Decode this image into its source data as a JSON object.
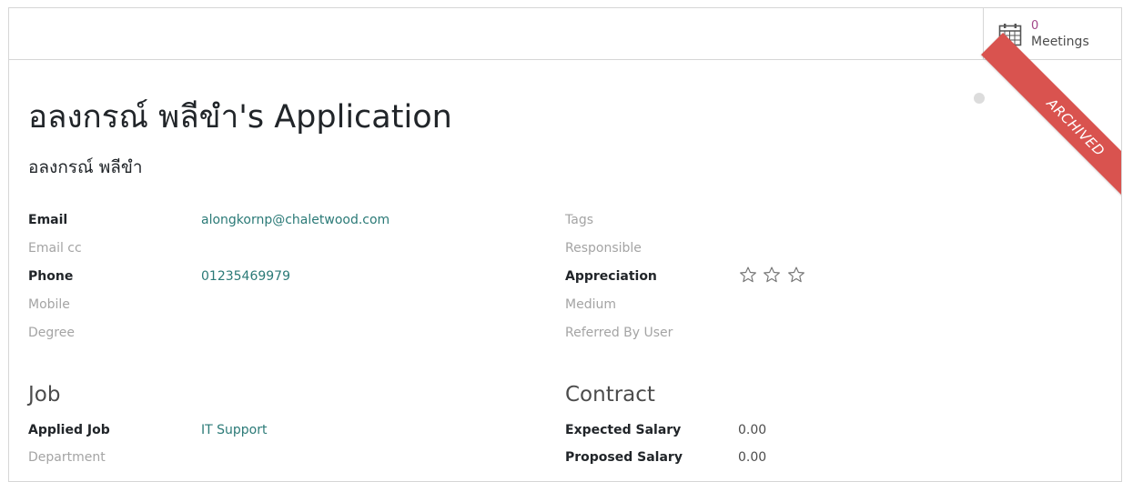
{
  "meetings": {
    "count": "0",
    "label": "Meetings"
  },
  "ribbon": {
    "text": "ARCHIVED"
  },
  "title": "อลงกรณ์ พลีขำ's Application",
  "partner_name": "อลงกรณ์ พลีขำ",
  "left_fields": {
    "email_label": "Email",
    "email_value": "alongkornp@chaletwood.com",
    "email_cc_label": "Email cc",
    "phone_label": "Phone",
    "phone_value": "01235469979",
    "mobile_label": "Mobile",
    "degree_label": "Degree"
  },
  "right_fields": {
    "tags_label": "Tags",
    "responsible_label": "Responsible",
    "appreciation_label": "Appreciation",
    "appreciation_stars": 0,
    "appreciation_max": 3,
    "medium_label": "Medium",
    "referred_label": "Referred By User"
  },
  "job_section": {
    "title": "Job",
    "applied_job_label": "Applied Job",
    "applied_job_value": "IT Support",
    "department_label": "Department"
  },
  "contract_section": {
    "title": "Contract",
    "expected_salary_label": "Expected Salary",
    "expected_salary_value": "0.00",
    "proposed_salary_label": "Proposed Salary",
    "proposed_salary_value": "0.00"
  },
  "colors": {
    "link": "#2b7a77",
    "ribbon": "#d9534f",
    "stat_value": "#a24689"
  }
}
